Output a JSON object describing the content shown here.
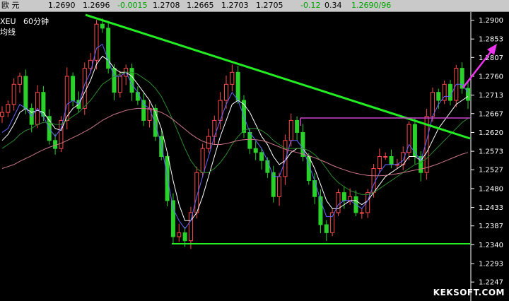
{
  "header": {
    "title": "欧 元",
    "quotes": [
      "1.2690",
      "1.2696",
      "-0.0015",
      "1.2708",
      "1.2665",
      "1.2703",
      "1.2705",
      "-0.12",
      "0.34",
      "1.2690/96"
    ]
  },
  "chart_label": {
    "symbol": "XEU",
    "period": "60分钟",
    "subtitle": "均线"
  },
  "watermark": "KEKSOFT.COM",
  "colors": {
    "background": "#000000",
    "trendline": "#22ee22",
    "resistance": "#cc44cc",
    "arrow": "#ee33ee",
    "ma_white": "#ffffff",
    "ma_blue": "#6666ff",
    "ma_green": "#2c8a2c",
    "ma_pink": "#cc7788"
  },
  "chart_data": {
    "type": "line",
    "title": "",
    "xlabel": "",
    "ylabel": "",
    "ylim": [
      1.2205,
      1.2915
    ],
    "yticks": [
      "1.2900",
      "1.2853",
      "1.2807",
      "1.2760",
      "1.2713",
      "1.2667",
      "1.2620",
      "1.2573",
      "1.2527",
      "1.2480",
      "1.2433",
      "1.2387",
      "1.2340",
      "1.2293",
      "1.2247"
    ],
    "series": [
      {
        "values": [
          1.267,
          1.269,
          1.274,
          1.276,
          1.268,
          1.264,
          1.272,
          1.266,
          1.26,
          1.258,
          1.265,
          1.276,
          1.27,
          1.268,
          1.278,
          1.28,
          1.289,
          1.288,
          1.278,
          1.272,
          1.276,
          1.278,
          1.272,
          1.27,
          1.265,
          1.268,
          1.261,
          1.256,
          1.245,
          1.236,
          1.237,
          1.235,
          1.242,
          1.252,
          1.258,
          1.261,
          1.265,
          1.27,
          1.274,
          1.277,
          1.27,
          1.262,
          1.258,
          1.257,
          1.255,
          1.252,
          1.246,
          1.251,
          1.26,
          1.265,
          1.262,
          1.256,
          1.25,
          1.246,
          1.239,
          1.237,
          1.242,
          1.247,
          1.245,
          1.246,
          1.242,
          1.242,
          1.247,
          1.253,
          1.256,
          1.256,
          1.254,
          1.254,
          1.257,
          1.264,
          1.256,
          1.252,
          1.266,
          1.272,
          1.27,
          1.274,
          1.27,
          1.278,
          1.273,
          1.27
        ]
      },
      {
        "values": [
          1.26,
          1.2615,
          1.264,
          1.267,
          1.268,
          1.267,
          1.2675,
          1.267,
          1.265,
          1.263,
          1.2625,
          1.266,
          1.268,
          1.269,
          1.272,
          1.275,
          1.279,
          1.281,
          1.28,
          1.278,
          1.277,
          1.277,
          1.276,
          1.274,
          1.272,
          1.27,
          1.267,
          1.263,
          1.257,
          1.25,
          1.244,
          1.24,
          1.24,
          1.242,
          1.246,
          1.251,
          1.256,
          1.261,
          1.265,
          1.269,
          1.27,
          1.269,
          1.267,
          1.264,
          1.261,
          1.259,
          1.256,
          1.254,
          1.255,
          1.257,
          1.258,
          1.258,
          1.256,
          1.253,
          1.249,
          1.245,
          1.243,
          1.243,
          1.244,
          1.245,
          1.245,
          1.244,
          1.245,
          1.247,
          1.249,
          1.251,
          1.252,
          1.253,
          1.254,
          1.256,
          1.256,
          1.255,
          1.257,
          1.26,
          1.263,
          1.265,
          1.267,
          1.269,
          1.27,
          1.271
        ]
      },
      {
        "values": [
          1.262,
          1.263,
          1.266,
          1.269,
          1.268,
          1.266,
          1.268,
          1.266,
          1.263,
          1.261,
          1.263,
          1.269,
          1.27,
          1.269,
          1.274,
          1.277,
          1.283,
          1.284,
          1.28,
          1.276,
          1.276,
          1.277,
          1.274,
          1.272,
          1.269,
          1.268,
          1.264,
          1.259,
          1.251,
          1.243,
          1.24,
          1.238,
          1.24,
          1.246,
          1.251,
          1.256,
          1.261,
          1.265,
          1.269,
          1.272,
          1.27,
          1.266,
          1.262,
          1.26,
          1.258,
          1.255,
          1.251,
          1.251,
          1.255,
          1.26,
          1.26,
          1.258,
          1.254,
          1.25,
          1.245,
          1.241,
          1.241,
          1.244,
          1.245,
          1.245,
          1.244,
          1.243,
          1.245,
          1.249,
          1.252,
          1.254,
          1.254,
          1.254,
          1.255,
          1.259,
          1.257,
          1.255,
          1.26,
          1.266,
          1.269,
          1.271,
          1.271,
          1.274,
          1.274,
          1.272
        ]
      },
      {
        "values": [
          1.258,
          1.259,
          1.26,
          1.2615,
          1.2625,
          1.263,
          1.264,
          1.2645,
          1.2645,
          1.264,
          1.264,
          1.265,
          1.266,
          1.267,
          1.2685,
          1.27,
          1.272,
          1.274,
          1.275,
          1.276,
          1.2765,
          1.277,
          1.277,
          1.2765,
          1.2755,
          1.2745,
          1.273,
          1.271,
          1.268,
          1.265,
          1.2615,
          1.258,
          1.255,
          1.253,
          1.252,
          1.252,
          1.253,
          1.2545,
          1.2565,
          1.259,
          1.261,
          1.2625,
          1.263,
          1.263,
          1.2625,
          1.2615,
          1.26,
          1.259,
          1.258,
          1.258,
          1.258,
          1.258,
          1.2575,
          1.2565,
          1.255,
          1.253,
          1.251,
          1.2495,
          1.2485,
          1.2475,
          1.247,
          1.2465,
          1.2465,
          1.247,
          1.248,
          1.249,
          1.25,
          1.251,
          1.252,
          1.253,
          1.254,
          1.2545,
          1.2555,
          1.257,
          1.2585,
          1.26,
          1.2615,
          1.263,
          1.2645,
          1.2655
        ]
      },
      {
        "values": [
          1.253,
          1.2535,
          1.254,
          1.2548,
          1.2555,
          1.2562,
          1.257,
          1.2577,
          1.2583,
          1.2588,
          1.2593,
          1.26,
          1.2607,
          1.2614,
          1.2622,
          1.263,
          1.264,
          1.265,
          1.2658,
          1.2665,
          1.267,
          1.2675,
          1.2678,
          1.268,
          1.268,
          1.2678,
          1.2675,
          1.267,
          1.2662,
          1.2652,
          1.264,
          1.2628,
          1.2616,
          1.2606,
          1.2598,
          1.2593,
          1.259,
          1.259,
          1.2592,
          1.2596,
          1.26,
          1.2602,
          1.2603,
          1.2602,
          1.26,
          1.2596,
          1.259,
          1.2584,
          1.2578,
          1.2574,
          1.257,
          1.2566,
          1.2562,
          1.2557,
          1.2551,
          1.2545,
          1.2538,
          1.2532,
          1.2527,
          1.2522,
          1.2518,
          1.2515,
          1.2513,
          1.2512,
          1.2512,
          1.2513,
          1.2515,
          1.2517,
          1.252,
          1.2523,
          1.2526,
          1.2529,
          1.2532,
          1.2537,
          1.2542,
          1.2548,
          1.2554,
          1.256,
          1.2566,
          1.257
        ]
      }
    ]
  }
}
